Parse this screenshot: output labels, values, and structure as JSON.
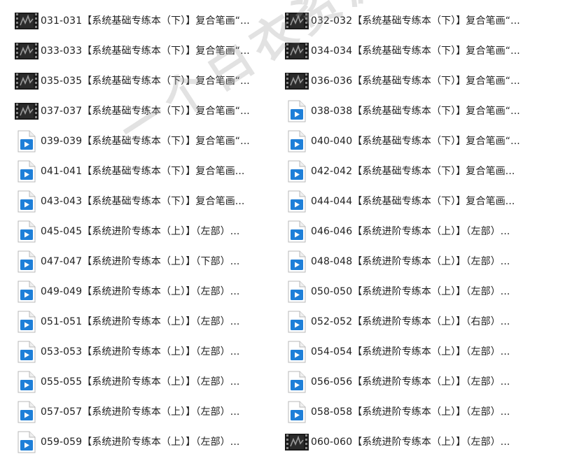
{
  "watermark": "一个白衣资源网",
  "files": [
    {
      "icon": "video-thumbnail-icon",
      "name": "031-031【系统基础专练本（下）】复合笔画“..."
    },
    {
      "icon": "video-thumbnail-icon",
      "name": "032-032【系统基础专练本（下）】复合笔画“..."
    },
    {
      "icon": "video-thumbnail-icon",
      "name": "033-033【系统基础专练本（下）】复合笔画“..."
    },
    {
      "icon": "video-thumbnail-icon",
      "name": "034-034【系统基础专练本（下）】复合笔画“..."
    },
    {
      "icon": "video-thumbnail-icon",
      "name": "035-035【系统基础专练本（下）】复合笔画“..."
    },
    {
      "icon": "video-thumbnail-icon",
      "name": "036-036【系统基础专练本（下）】复合笔画“..."
    },
    {
      "icon": "video-thumbnail-icon",
      "name": "037-037【系统基础专练本（下）】复合笔画“..."
    },
    {
      "icon": "video-file-icon",
      "name": "038-038【系统基础专练本（下）】复合笔画“..."
    },
    {
      "icon": "video-file-icon",
      "name": "039-039【系统基础专练本（下）】复合笔画“..."
    },
    {
      "icon": "video-file-icon",
      "name": "040-040【系统基础专练本（下）】复合笔画“..."
    },
    {
      "icon": "video-file-icon",
      "name": "041-041【系统基础专练本（下）】复合笔画..."
    },
    {
      "icon": "video-file-icon",
      "name": "042-042【系统基础专练本（下）】复合笔画..."
    },
    {
      "icon": "video-file-icon",
      "name": "043-043【系统基础专练本（下）】复合笔画..."
    },
    {
      "icon": "video-file-icon",
      "name": "044-044【系统基础专练本（下）】复合笔画..."
    },
    {
      "icon": "video-file-icon",
      "name": "045-045【系统进阶专练本（上）】（左部）..."
    },
    {
      "icon": "video-file-icon",
      "name": "046-046【系统进阶专练本（上）】（左部）..."
    },
    {
      "icon": "video-file-icon",
      "name": "047-047【系统进阶专练本（上）】（下部）..."
    },
    {
      "icon": "video-file-icon",
      "name": "048-048【系统进阶专练本（上）】（左部）..."
    },
    {
      "icon": "video-file-icon",
      "name": "049-049【系统进阶专练本（上）】（左部）..."
    },
    {
      "icon": "video-file-icon",
      "name": "050-050【系统进阶专练本（上）】（左部）..."
    },
    {
      "icon": "video-file-icon",
      "name": "051-051【系统进阶专练本（上）】（左部）..."
    },
    {
      "icon": "video-file-icon",
      "name": "052-052【系统进阶专练本（上）】（右部）..."
    },
    {
      "icon": "video-file-icon",
      "name": "053-053【系统进阶专练本（上）】（左部）..."
    },
    {
      "icon": "video-file-icon",
      "name": "054-054【系统进阶专练本（上）】（左部）..."
    },
    {
      "icon": "video-file-icon",
      "name": "055-055【系统进阶专练本（上）】（左部）..."
    },
    {
      "icon": "video-file-icon",
      "name": "056-056【系统进阶专练本（上）】（左部）..."
    },
    {
      "icon": "video-file-icon",
      "name": "057-057【系统进阶专练本（上）】（左部）..."
    },
    {
      "icon": "video-file-icon",
      "name": "058-058【系统进阶专练本（上）】（左部）..."
    },
    {
      "icon": "video-file-icon",
      "name": "059-059【系统进阶专练本（上）】（左部）..."
    },
    {
      "icon": "video-thumbnail-icon",
      "name": "060-060【系统进阶专练本（上）】（左部）..."
    }
  ]
}
